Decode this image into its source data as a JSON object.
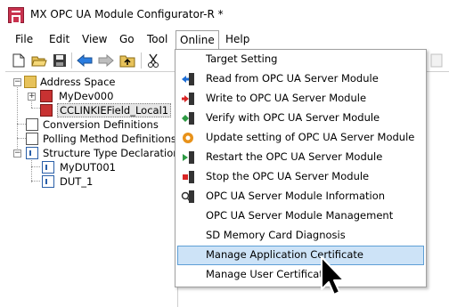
{
  "window": {
    "title": "MX OPC UA Module Configurator-R *"
  },
  "menubar": {
    "items": [
      {
        "label": "File"
      },
      {
        "label": "Edit"
      },
      {
        "label": "View"
      },
      {
        "label": "Go"
      },
      {
        "label": "Tool"
      },
      {
        "label": "Online"
      },
      {
        "label": "Help"
      }
    ],
    "active": "Online"
  },
  "toolbar": {
    "icons": [
      "new-file-icon",
      "open-folder-icon",
      "save-icon",
      "back-arrow-icon",
      "forward-arrow-icon",
      "up-folder-icon",
      "cut-icon"
    ]
  },
  "tree": {
    "address_space": "Address Space",
    "mydev000": "MyDev000",
    "cclinkie": "CCLINKIEField_Local1",
    "conversion": "Conversion Definitions",
    "polling": "Polling Method Definitions",
    "structure": "Structure Type Declarations",
    "mydut001": "MyDUT001",
    "dut1": "DUT_1"
  },
  "online_menu": {
    "items": [
      {
        "label": "Target Setting",
        "icon": ""
      },
      {
        "label": "Read from OPC UA Server Module",
        "icon": "read-from-module-icon"
      },
      {
        "label": "Write to OPC UA Server Module",
        "icon": "write-to-module-icon"
      },
      {
        "label": "Verify with OPC UA Server Module",
        "icon": "verify-module-icon"
      },
      {
        "label": "Update setting of OPC UA Server Module",
        "icon": "update-setting-icon"
      },
      {
        "label": "Restart the OPC UA Server Module",
        "icon": "restart-module-icon"
      },
      {
        "label": "Stop the OPC UA Server Module",
        "icon": "stop-module-icon"
      },
      {
        "label": "OPC UA Server Module Information",
        "icon": "module-information-icon"
      },
      {
        "label": "OPC UA Server Module Management",
        "icon": ""
      },
      {
        "label": "SD Memory Card Diagnosis",
        "icon": ""
      },
      {
        "label": "Manage Application Certificate",
        "icon": ""
      },
      {
        "label": "Manage User Certificate",
        "icon": ""
      }
    ],
    "highlighted": "Manage Application Certificate"
  },
  "colors": {
    "highlight_bg": "#cde3f7",
    "highlight_border": "#5e9fd6",
    "app_icon": "#c8324e"
  }
}
